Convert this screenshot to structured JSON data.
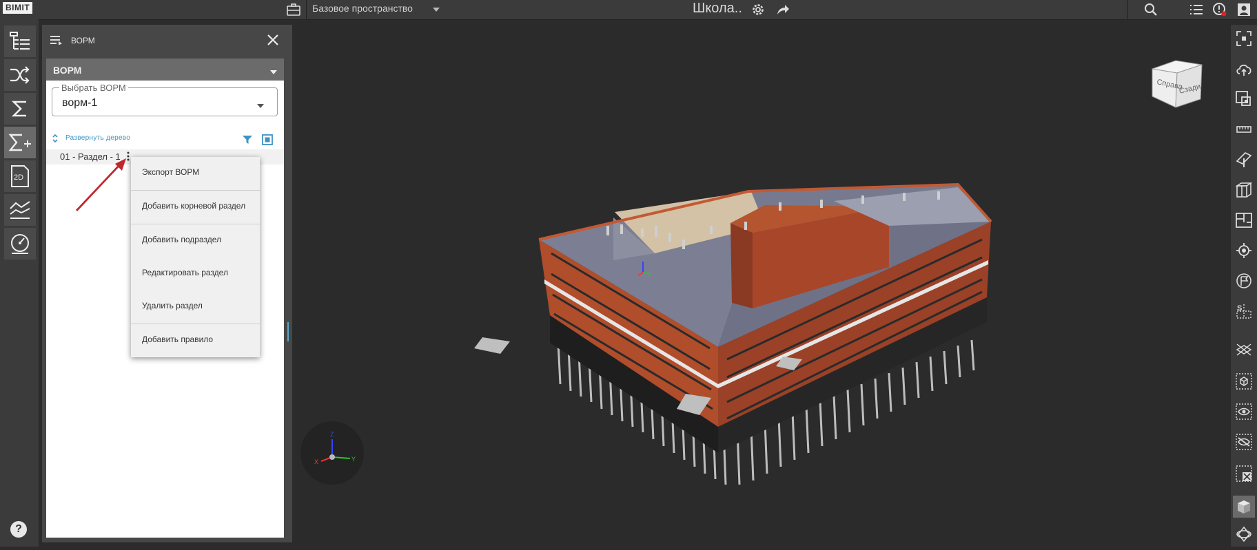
{
  "app": {
    "logo": "BIMIT",
    "space_label": "Базовое пространство",
    "project_title": "Школа.."
  },
  "panel": {
    "title": "ВОРМ",
    "section_title": "ВОРМ",
    "select_label": "Выбрать ВОРМ",
    "select_value": "ворм-1",
    "expand_tree": "Развернуть дерево",
    "tree_item": "01 - Раздел - 1"
  },
  "context_menu": {
    "items": [
      "Экспорт ВОРМ",
      "Добавить корневой раздел",
      "Добавить подраздел",
      "Редактировать раздел",
      "Удалить раздел",
      "Добавить правило"
    ]
  },
  "viewcube": {
    "face_front": "Справа",
    "face_side": "Сзади"
  },
  "axes": {
    "x": "X",
    "y": "Y",
    "z": "Z"
  },
  "help": "?",
  "left_rail_icons": [
    "tree-icon",
    "shuffle-icon",
    "sum-icon",
    "sum-plus-icon",
    "plan-2d-icon",
    "chart-lines-icon",
    "gauge-icon"
  ],
  "right_rail_icons": [
    "fit-view-icon",
    "cloud-upload-icon",
    "select-area-icon",
    "ruler-icon",
    "section-plane-icon",
    "section-box-icon",
    "floor-plan-icon",
    "target-icon",
    "flag-icon",
    "transform-icon",
    "cross-section-icon",
    "box-select-icon",
    "show-icon",
    "hide-icon",
    "clear-selection-icon",
    "solid-view-icon",
    "orbit-icon"
  ],
  "colors": {
    "accent": "#3c94c2",
    "arrow": "#c0272d",
    "facade": "#b5512f",
    "roof": "#7c7f93"
  }
}
